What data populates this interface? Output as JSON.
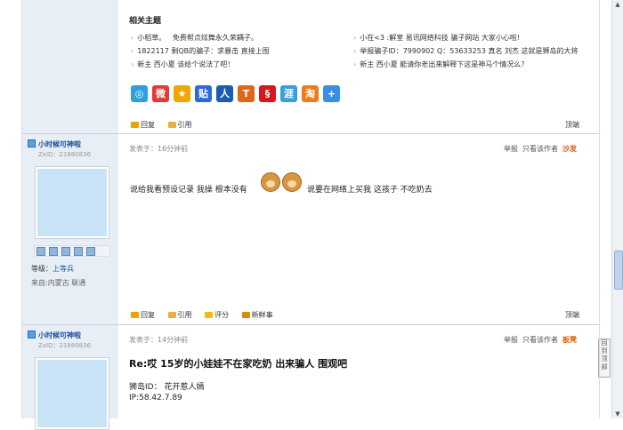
{
  "related": {
    "title": "相关主题",
    "left_items": [
      "小稻草。",
      "免费帮点炫舞永久荣耦子。",
      "1822117 剩QB的骗子：求暴击 直接上图",
      "新主 西小夏 该给个说法了吧！"
    ],
    "right_items": [
      "小在<3 :解室 易讯网络科技 骗子网站 大家小心啦!",
      "举报骗子ID：7990902 Q：53633253 真名 刘杰 这就是狮岛的大将",
      "新主 西小夏 能请你老出来解释下这是神马个情况么？"
    ]
  },
  "share_icons": [
    {
      "name": "qzone-share-icon",
      "label": "◎",
      "color": "#2f9fe0"
    },
    {
      "name": "weibo-share-icon",
      "label": "微",
      "color": "#e4393c"
    },
    {
      "name": "star-share-icon",
      "label": "★",
      "color": "#f0a800"
    },
    {
      "name": "tieba-share-icon",
      "label": "贴",
      "color": "#2b6ad8"
    },
    {
      "name": "renren-share-icon",
      "label": "人",
      "color": "#1d5cb3"
    },
    {
      "name": "tianya-share-icon",
      "label": "T",
      "color": "#e2661a"
    },
    {
      "name": "t163-share-icon",
      "label": "§",
      "color": "#d7161e"
    },
    {
      "name": "huaban-share-icon",
      "label": "涯",
      "color": "#3aa0d8"
    },
    {
      "name": "taobao-share-icon",
      "label": "淘",
      "color": "#f07b1d"
    },
    {
      "name": "more-share-icon",
      "label": "+",
      "color": "#3a8fe0"
    }
  ],
  "first_actions": {
    "reply": "回复",
    "quote": "引用",
    "top": "顶端"
  },
  "post1": {
    "username": "小时候可神啦",
    "uid": "ZxID：21880836",
    "posted": "发表于：16分钟前",
    "report": "举报",
    "author_only": "只看该作者",
    "floor": "沙发",
    "rank_label": "等级：",
    "rank": "上等兵",
    "from": "来自:内蒙古 联通",
    "content_before": "说给我看预设记录 我操 根本没有",
    "content_after": "说要在网络上买我 这孩子 不吃奶去",
    "actions": {
      "reply": "回复",
      "quote": "引用",
      "rate": "评分",
      "fresh": "新鲜事",
      "top": "顶端"
    }
  },
  "post2": {
    "username": "小时候可神啦",
    "uid": "ZxID：21880836",
    "posted": "发表于：14分钟前",
    "report": "举报",
    "author_only": "只看该作者",
    "floor": "板凳",
    "title": "Re:哎 15岁的小娃娃不在家吃奶 出来骗人 围观吧",
    "line1": "狮岛ID： 花开惹人嫣",
    "line2": "IP:58.42.7.89"
  },
  "gotop": "回到顶部",
  "colors": {
    "link": "#1b4f9c",
    "floor": "#e05b00",
    "sidebar": "#e8eef5"
  }
}
